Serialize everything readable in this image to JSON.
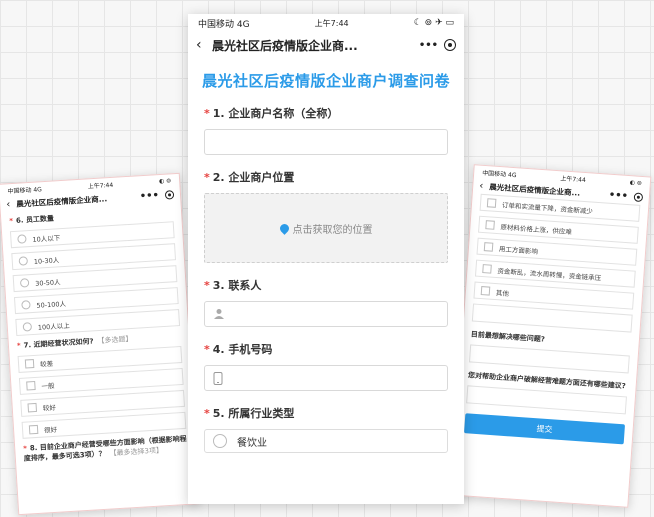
{
  "main": {
    "status": {
      "carrier": "中国移动 4G",
      "time": "上午7:44",
      "icons": "☾ ⊚ ✈ ▭"
    },
    "nav": {
      "title": "晨光社区后疫情版企业商...",
      "more": "•••"
    },
    "survey_title": "晨光社区后疫情版企业商户调查问卷",
    "questions": [
      {
        "label": "1. 企业商户名称（全称）"
      },
      {
        "label": "2. 企业商户位置",
        "location_text": "点击获取您的位置"
      },
      {
        "label": "3. 联系人"
      },
      {
        "label": "4. 手机号码"
      },
      {
        "label": "5. 所属行业类型",
        "first_option": "餐饮业"
      }
    ]
  },
  "left": {
    "status": {
      "carrier": "中国移动 4G",
      "time": "上午7:44"
    },
    "nav": {
      "title": "晨光社区后疫情版企业商..."
    },
    "q6": {
      "label": "6. 员工数量",
      "options": [
        "10人以下",
        "10-30人",
        "30-50人",
        "50-100人",
        "100人以上"
      ]
    },
    "q7": {
      "label": "7. 近期经营状况如何?",
      "hint": "【多选题】",
      "options": [
        "较差",
        "一般",
        "较好",
        "很好"
      ]
    },
    "q8": {
      "label": "8. 目前企业商户经营受哪些方面影响（根据影响程度排序，最多可选3项）？",
      "hint": "【最多选择3项】"
    }
  },
  "right": {
    "status": {
      "carrier": "中国移动 4G",
      "time": "上午7:44"
    },
    "nav": {
      "title": "晨光社区后疫情版企业商..."
    },
    "options": [
      "订单和实流量下降，资金断减少",
      "原材料价格上涨，供应难",
      "用工方面影响",
      "资金断乱，流水周转慢，资金链承压",
      "其他"
    ],
    "q_next": {
      "label": "目前最想解决哪些问题?"
    },
    "q_next2": {
      "label": "您对帮助企业商户破解经营难题方面还有哪些建议?"
    },
    "submit": "提交"
  },
  "colors": {
    "accent": "#2b9be8",
    "required": "#e64340"
  }
}
